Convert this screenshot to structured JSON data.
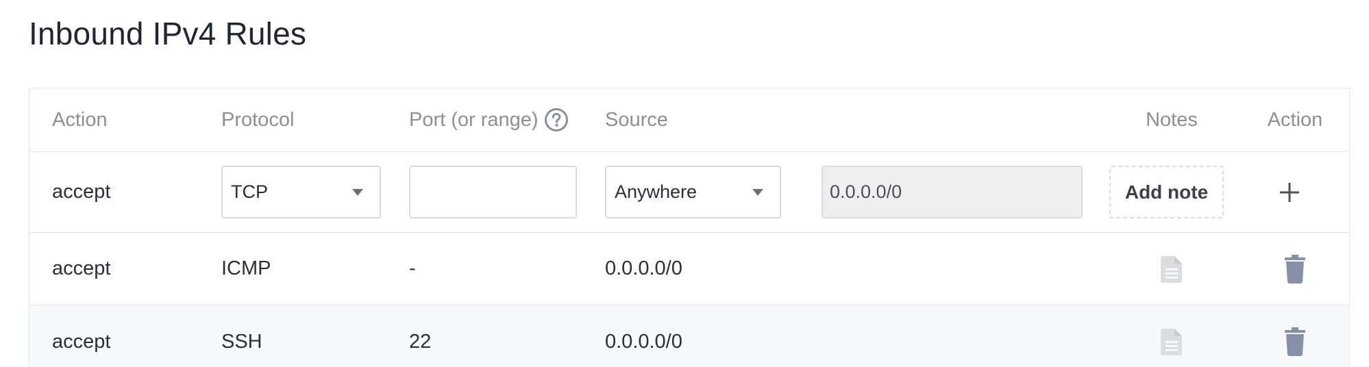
{
  "page": {
    "title": "Inbound IPv4 Rules"
  },
  "table": {
    "headers": {
      "action": "Action",
      "protocol": "Protocol",
      "port": "Port (or range)",
      "source": "Source",
      "notes": "Notes",
      "action2": "Action"
    },
    "form": {
      "action": "accept",
      "protocol_selected": "TCP",
      "port_value": "",
      "source_selected": "Anywhere",
      "cidr_value": "0.0.0.0/0",
      "add_note_label": "Add note"
    },
    "rows": [
      {
        "action": "accept",
        "protocol": "ICMP",
        "port": "-",
        "source": "0.0.0.0/0"
      },
      {
        "action": "accept",
        "protocol": "SSH",
        "port": "22",
        "source": "0.0.0.0/0"
      }
    ]
  },
  "icons": {
    "help": "question-circle-icon",
    "caret": "chevron-down-icon",
    "add": "plus-icon",
    "note": "document-icon",
    "delete": "trash-icon"
  },
  "colors": {
    "header_text": "#8b9097",
    "trash": "#8790a8",
    "note_icon": "#dcdde0",
    "striped_row": "#f8f9fb"
  }
}
